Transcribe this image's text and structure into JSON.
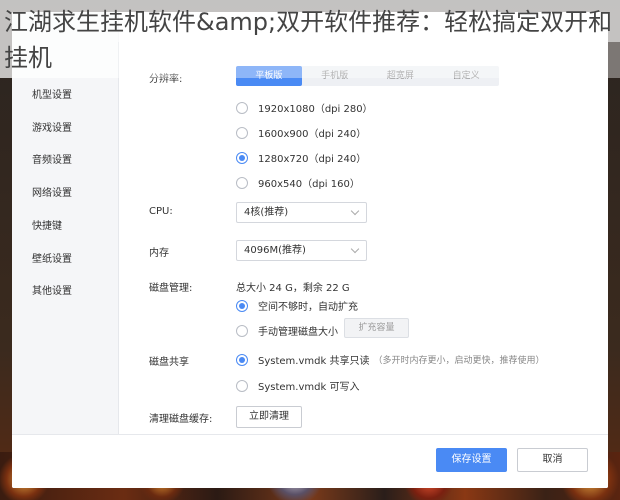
{
  "headline": "江湖求生挂机软件&amp;双开软件推荐：轻松搞定双开和挂机",
  "sidebar": {
    "items": [
      {
        "label": "机型设置"
      },
      {
        "label": "游戏设置"
      },
      {
        "label": "音频设置"
      },
      {
        "label": "网络设置"
      },
      {
        "label": "快捷键"
      },
      {
        "label": "壁纸设置"
      },
      {
        "label": "其他设置"
      }
    ]
  },
  "resolution": {
    "label": "分辨率:",
    "tabs": [
      "平板版",
      "手机版",
      "超宽屏",
      "自定义"
    ],
    "active_tab": 0,
    "options": [
      {
        "label": "1920x1080（dpi 280）",
        "checked": false
      },
      {
        "label": "1600x900（dpi 240）",
        "checked": false
      },
      {
        "label": "1280x720（dpi 240）",
        "checked": true
      },
      {
        "label": "960x540（dpi 160）",
        "checked": false
      }
    ]
  },
  "cpu": {
    "label": "CPU:",
    "value": "4核(推荐)"
  },
  "memory": {
    "label": "内存",
    "value": "4096M(推荐)"
  },
  "disk": {
    "label": "磁盘管理:",
    "summary": "总大小 24 G，剩余 22 G",
    "options": [
      {
        "label": "空间不够时，自动扩充",
        "checked": true
      },
      {
        "label": "手动管理磁盘大小",
        "checked": false
      }
    ],
    "expand_button": "扩充容量"
  },
  "shared_disk": {
    "label": "磁盘共享",
    "options": [
      {
        "label": "System.vmdk 共享只读",
        "note": "（多开时内存更小，启动更快，推荐使用）",
        "checked": true
      },
      {
        "label": "System.vmdk 可写入",
        "note": "",
        "checked": false
      }
    ]
  },
  "clear_cache": {
    "label": "清理磁盘缓存:",
    "button": "立即清理"
  },
  "footer": {
    "save": "保存设置",
    "cancel": "取消"
  },
  "colors": {
    "accent": "#4a8af4",
    "sidebar_bg": "#f5f6f8"
  }
}
